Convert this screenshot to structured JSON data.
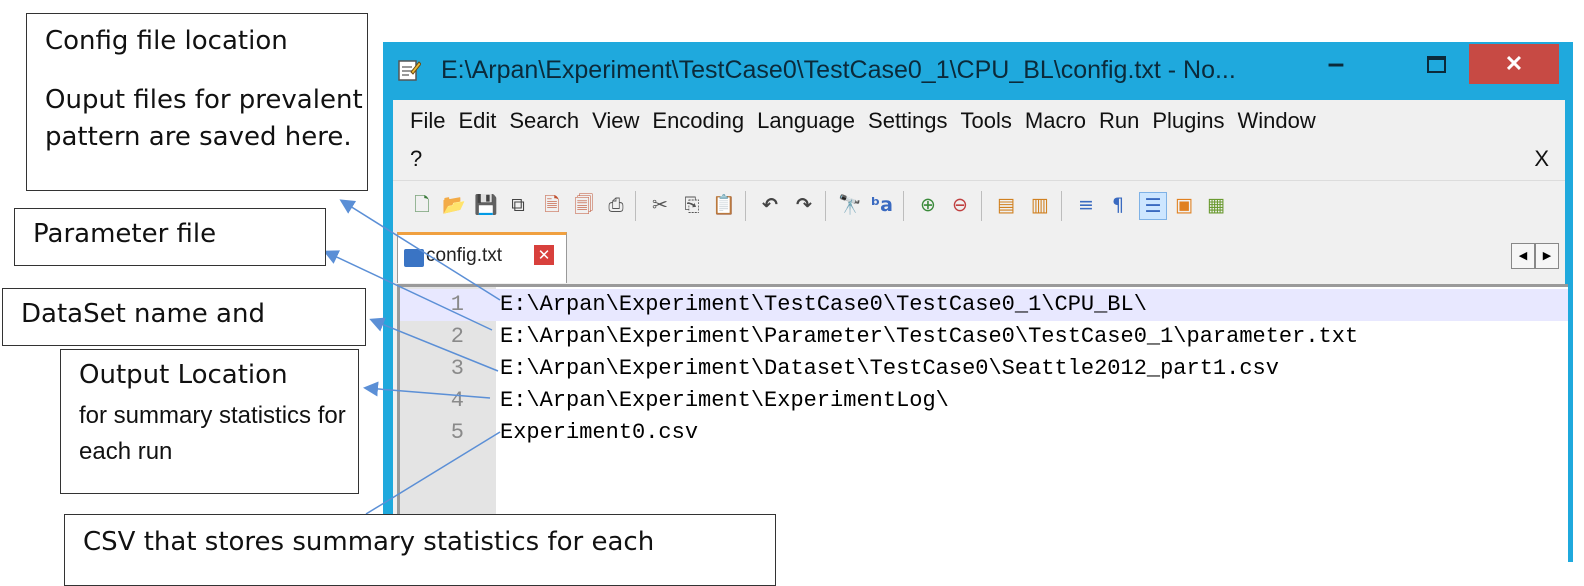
{
  "window": {
    "title": "E:\\Arpan\\Experiment\\TestCase0\\TestCase0_1\\CPU_BL\\config.txt - No...",
    "minimize_glyph": "–",
    "close_glyph": "✕"
  },
  "menu": {
    "items": [
      "File",
      "Edit",
      "Search",
      "View",
      "Encoding",
      "Language",
      "Settings",
      "Tools",
      "Macro",
      "Run",
      "Plugins",
      "Window"
    ],
    "help": "?",
    "close_doc": "X"
  },
  "toolbar": {
    "icons": [
      "new-file-icon",
      "open-file-icon",
      "save-icon",
      "save-all-icon",
      "close-icon",
      "close-all-icon",
      "print-icon",
      "cut-icon",
      "copy-icon",
      "paste-icon",
      "undo-icon",
      "redo-icon",
      "find-icon",
      "replace-icon",
      "zoom-in-icon",
      "zoom-out-icon",
      "sync-vertical-icon",
      "sync-horizontal-icon",
      "word-wrap-icon",
      "show-all-chars-icon",
      "indent-guide-icon",
      "user-language-icon",
      "doc-map-icon"
    ]
  },
  "tab": {
    "label": "config.txt",
    "close_glyph": "✕"
  },
  "editor": {
    "lines": [
      {
        "num": "1",
        "text": "E:\\Arpan\\Experiment\\TestCase0\\TestCase0_1\\CPU_BL\\"
      },
      {
        "num": "2",
        "text": "E:\\Arpan\\Experiment\\Parameter\\TestCase0\\TestCase0_1\\parameter.txt"
      },
      {
        "num": "3",
        "text": "E:\\Arpan\\Experiment\\Dataset\\TestCase0\\Seattle2012_part1.csv"
      },
      {
        "num": "4",
        "text": "E:\\Arpan\\Experiment\\ExperimentLog\\"
      },
      {
        "num": "5",
        "text": "Experiment0.csv"
      }
    ]
  },
  "callouts": {
    "config_title": "Config file location",
    "config_body": "Ouput files for prevalent pattern are saved here.",
    "parameter": "Parameter file",
    "dataset": "DataSet name and",
    "output_title": "Output Location",
    "output_body": "for summary statistics for each run",
    "csv": "CSV that stores summary statistics for each"
  },
  "colors": {
    "window_frame": "#1fa9dd",
    "close_button": "#c74a44",
    "tab_accent": "#f0a040",
    "current_line": "#e8e8ff",
    "arrow": "#5b8fd6"
  }
}
